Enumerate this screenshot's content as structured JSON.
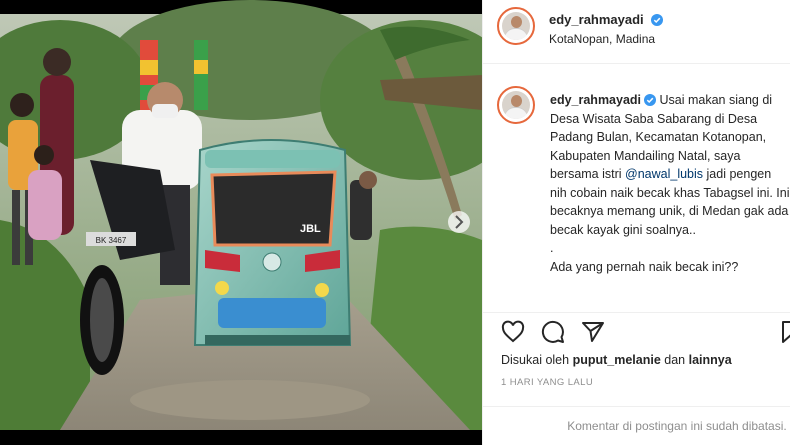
{
  "header": {
    "username": "edy_rahmayadi",
    "location": "KotaNopan, Madina"
  },
  "caption": {
    "username": "edy_rahmayadi",
    "text_before_mention": "Usai makan siang di Desa Wisata Saba Sabarang di Desa Padang Bulan, Kecamatan Kotanopan, Kabupaten Mandailing Natal, saya bersama istri",
    "mention": "@nawal_lubis",
    "text_after_mention": "jadi pengen nih cobain naik becak khas Tabagsel ini. Ini becaknya memang unik, di Medan gak ada becak kayak gini soalnya..",
    "dot": ".",
    "question": "Ada yang pernah naik becak ini??"
  },
  "likes": {
    "prefix": "Disukai oleh",
    "user": "puput_melanie",
    "connector": "dan",
    "others": "lainnya"
  },
  "timestamp": "1 HARI YANG LALU",
  "comments_disabled": "Komentar di postingan ini sudah dibatasi.",
  "photo": {
    "plate_number": "BK 3467",
    "becak_sticker": "JBL"
  },
  "icons": {
    "verified": "verified-badge-icon",
    "like": "heart-icon",
    "comment": "comment-bubble-icon",
    "share": "paper-plane-icon",
    "save": "bookmark-icon"
  },
  "colors": {
    "verified": "#3897f0",
    "mention": "#00376b",
    "muted": "#8e8e8e",
    "border": "#efefef"
  }
}
